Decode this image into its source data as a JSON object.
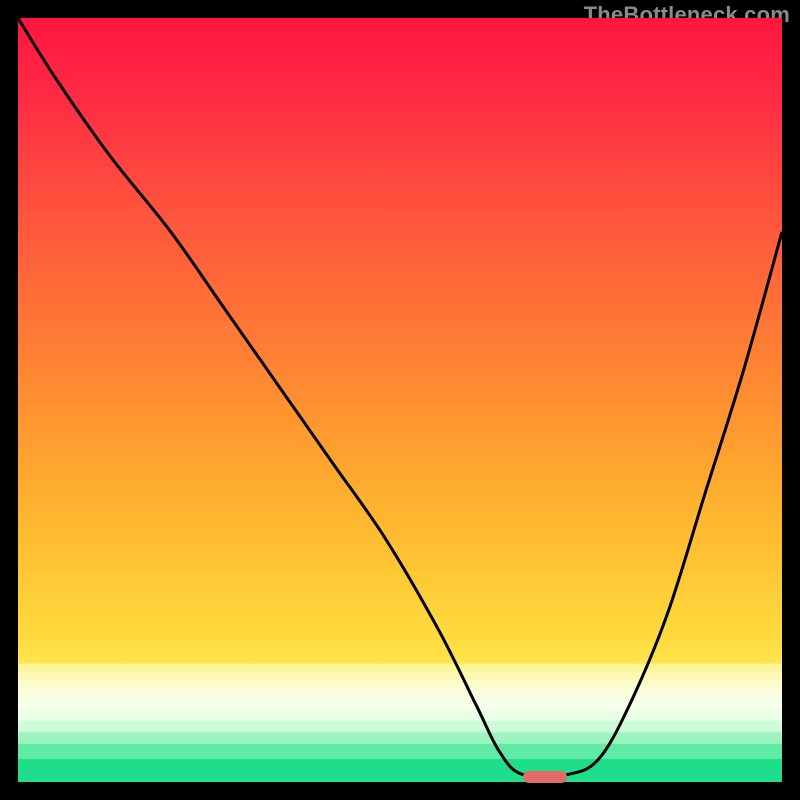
{
  "watermark": "TheBottleneck.com",
  "chart_data": {
    "type": "line",
    "title": "",
    "xlabel": "",
    "ylabel": "",
    "xlim": [
      0,
      100
    ],
    "ylim": [
      0,
      100
    ],
    "background": {
      "upper_gradient": {
        "from": "#ff1a47",
        "to": "#ffe84a",
        "yrange": [
          16,
          100
        ]
      },
      "lower_bands": [
        {
          "y": 15.5,
          "color": "#fff59a"
        },
        {
          "y": 14.5,
          "color": "#fff8b0"
        },
        {
          "y": 13.5,
          "color": "#fdfcc8"
        },
        {
          "y": 12.5,
          "color": "#fafddc"
        },
        {
          "y": 11.0,
          "color": "#f5fee8"
        },
        {
          "y": 9.5,
          "color": "#e9ffe6"
        },
        {
          "y": 8.0,
          "color": "#ccfcd8"
        },
        {
          "y": 6.5,
          "color": "#9df4c0"
        },
        {
          "y": 5.0,
          "color": "#60eaa5"
        },
        {
          "y": 3.0,
          "color": "#1ede89"
        },
        {
          "y": 0.0,
          "color": "#00d276"
        }
      ]
    },
    "series": [
      {
        "name": "bottleneck-curve",
        "color": "#000000",
        "width": 3,
        "x": [
          0,
          5,
          12,
          20,
          27,
          34,
          41,
          48,
          55,
          60,
          63,
          66,
          72,
          76,
          80,
          85,
          90,
          95,
          100
        ],
        "y": [
          100,
          92,
          82,
          72,
          62,
          52,
          42,
          32,
          20,
          10,
          4,
          1,
          1,
          3,
          10,
          22,
          38,
          54,
          72
        ]
      }
    ],
    "marker": {
      "name": "optimal-point",
      "shape": "pill",
      "color": "#e46a6a",
      "x_center": 69,
      "y_center": 0.7,
      "width_pct": 5.8,
      "height_pct": 1.6
    }
  }
}
